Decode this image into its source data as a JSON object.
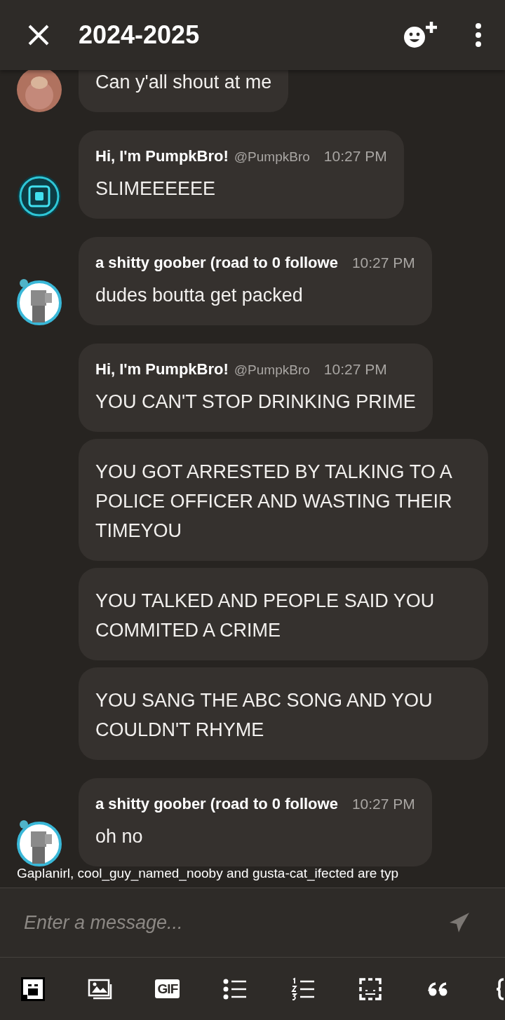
{
  "header": {
    "title": "2024-2025"
  },
  "groups": [
    {
      "kind": "bear",
      "messages": [
        {
          "text": "Can y'all shout at me"
        }
      ]
    },
    {
      "kind": "ring",
      "messages": [
        {
          "author": "Hi, I'm PumpkBro!",
          "handle": "@PumpkBro",
          "time": "10:27 PM",
          "text": "SLIMEEEEEE"
        }
      ]
    },
    {
      "kind": "figure",
      "messages": [
        {
          "author": "a shitty goober (road to 0 followe",
          "time": "10:27 PM",
          "text": "dudes boutta get packed"
        }
      ]
    },
    {
      "messages": [
        {
          "author": "Hi, I'm PumpkBro!",
          "handle": "@PumpkBro",
          "time": "10:27 PM",
          "text": "YOU CAN'T STOP DRINKING PRIME"
        },
        {
          "text": "YOU GOT ARRESTED BY TALKING TO A POLICE OFFICER AND WASTING THEIR TIMEYOU"
        },
        {
          "text": "YOU TALKED AND PEOPLE SAID YOU COMMITED A CRIME"
        },
        {
          "text": "YOU SANG THE ABC SONG AND YOU COULDN'T RHYME"
        }
      ]
    },
    {
      "kind": "figure",
      "messages": [
        {
          "author": "a shitty goober (road to 0 followe",
          "time": "10:27 PM",
          "text": "oh no"
        }
      ]
    }
  ],
  "typing": "Gaplanirl, cool_guy_named_nooby and gusta-cat_ifected are typ",
  "composer": {
    "placeholder": "Enter a message..."
  },
  "toolbar": [
    {
      "kind": "sticker"
    },
    {
      "kind": "image"
    },
    {
      "kind": "gif",
      "label": "GIF"
    },
    {
      "kind": "bullets"
    },
    {
      "kind": "numbers"
    },
    {
      "kind": "spoiler"
    },
    {
      "kind": "quote"
    },
    {
      "kind": "code"
    }
  ]
}
